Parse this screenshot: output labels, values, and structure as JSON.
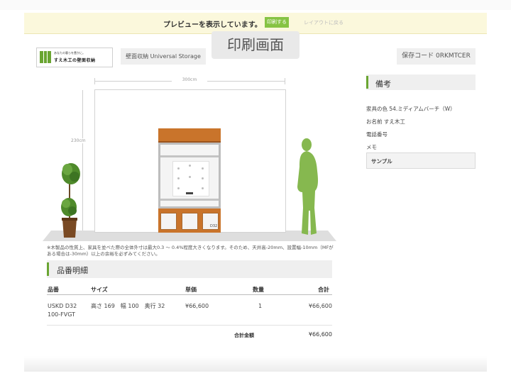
{
  "banner": {
    "message": "プレビューを表示しています。",
    "print_button": "印刷する",
    "back_link": "レイアウトに戻る"
  },
  "header": {
    "logo_subtitle": "あなたの暮らを豊かに。",
    "logo_text": "すえ木工の壁面収納",
    "product_name": "壁面収納 Universal Storage",
    "print_screen_label": "印刷画面",
    "save_code": "保存コード 0RKMTCER"
  },
  "preview": {
    "width_label": "300cm",
    "height_label": "230cm",
    "cabinet_code": "D32",
    "note": "※木製品の性質上、家具を並べた際の全体外寸は最大0.3 ～ 0.4%程度大きくなります。そのため、天井高-20mm、設置幅-10mm（MFがある場合は-30mm）以上の余裕を必ずみてください。"
  },
  "parts": {
    "title": "品番明細",
    "columns": [
      "品番",
      "サイズ",
      "単価",
      "数量",
      "合計"
    ],
    "rows": [
      {
        "code_line1": "USKD D32",
        "code_line2": "100-FVGT",
        "size": "高さ 169　幅 100　奥行 32",
        "unit_price": "¥66,600",
        "qty": "1",
        "total": "¥66,600"
      }
    ],
    "total_label": "合計金額",
    "total_value": "¥66,600"
  },
  "remarks": {
    "title": "備考",
    "furniture_color": "家具の色 54.ミディアムバーチ（W）",
    "name": "お名前 すえ木工",
    "phone": "電話番号",
    "memo_label": "メモ",
    "memo_value": "サンプル"
  },
  "colors": {
    "accent_green": "#6aa532",
    "banner_bg": "#fbf8dc",
    "wood": "#c9742b"
  }
}
